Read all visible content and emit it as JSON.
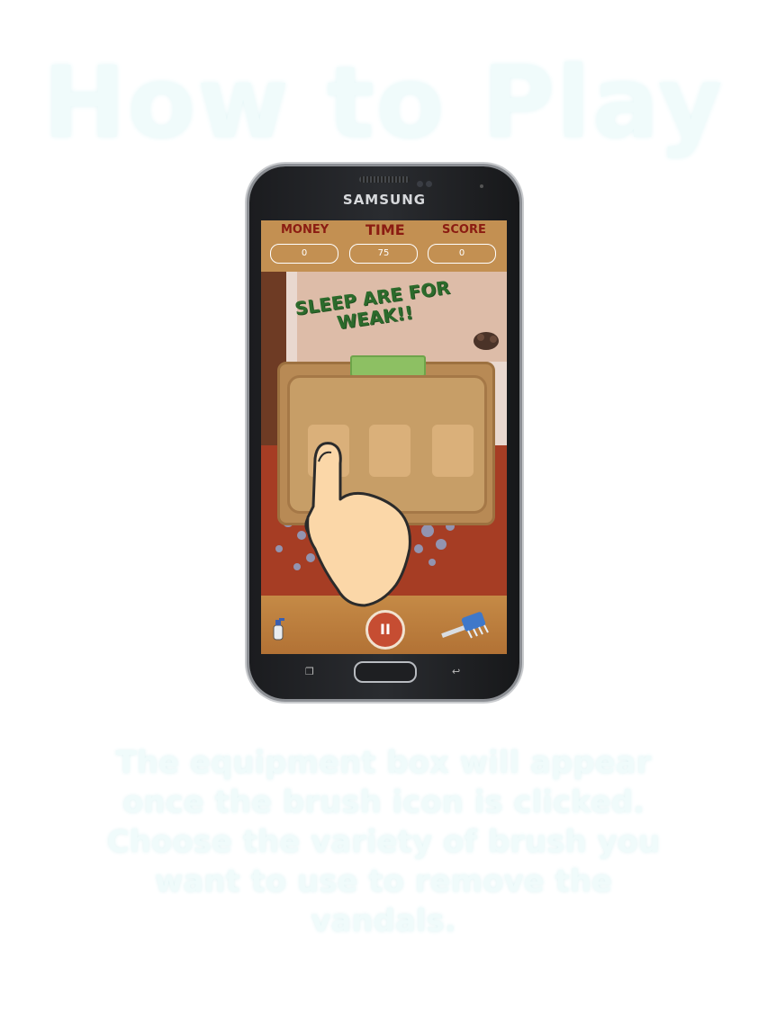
{
  "title": "How to Play",
  "phone": {
    "brand": "SAMSUNG"
  },
  "hud": {
    "money_label": "MONEY",
    "time_label": "TIME",
    "score_label": "SCORE",
    "money_value": "0",
    "time_value": "75",
    "score_value": "0"
  },
  "scene": {
    "slogan": "SLEEP ARE FOR WEAK!!"
  },
  "equipment_box": {
    "slot_count": 3,
    "selected_item_icon": "brush-icon"
  },
  "controls": {
    "pause_icon": "pause-icon",
    "pause_symbol": "II",
    "left_tool_icon": "spray-bottle-icon",
    "right_tool_icon": "brush-icon"
  },
  "instructions": {
    "text": "The equipment box will appear once the brush icon is clicked. Choose the variety of brush you want to use to remove the vandals."
  },
  "colors": {
    "title_color": "#f0fbfb",
    "hud_label_color": "#8b1c12",
    "slogan_color": "#2c6b2c",
    "pause_color": "#c64d32"
  }
}
